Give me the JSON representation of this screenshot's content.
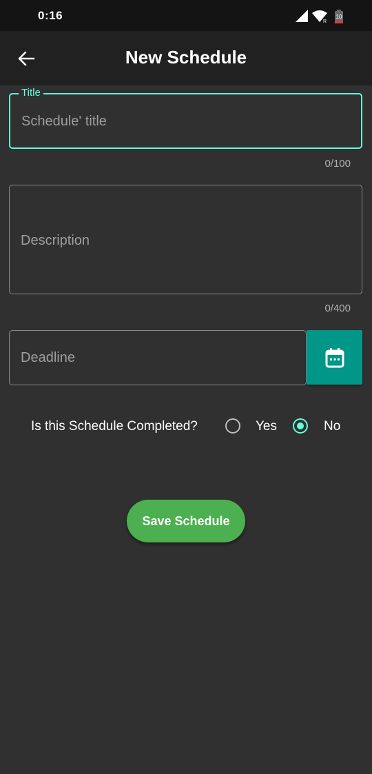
{
  "status_bar": {
    "time": "0:16",
    "battery_level": "10",
    "icons": [
      "signal-icon",
      "wifi-icon",
      "battery-icon"
    ]
  },
  "app_bar": {
    "title": "New Schedule",
    "back_icon": "arrow-left-icon"
  },
  "form": {
    "title": {
      "label": "Title",
      "placeholder": "Schedule' title",
      "value": "",
      "counter": "0/100"
    },
    "description": {
      "placeholder": "Description",
      "value": "",
      "counter": "0/400"
    },
    "deadline": {
      "placeholder": "Deadline",
      "value": "",
      "calendar_icon": "calendar-icon"
    },
    "completed": {
      "question": "Is this Schedule Completed?",
      "options": [
        {
          "label": "Yes",
          "checked": false
        },
        {
          "label": "No",
          "checked": true
        }
      ]
    },
    "save_label": "Save Schedule"
  },
  "colors": {
    "background": "#303030",
    "app_bar": "#212121",
    "status_bar": "#141414",
    "accent": "#64ffda",
    "calendar_button": "#009688",
    "save_button": "#4caf50"
  }
}
